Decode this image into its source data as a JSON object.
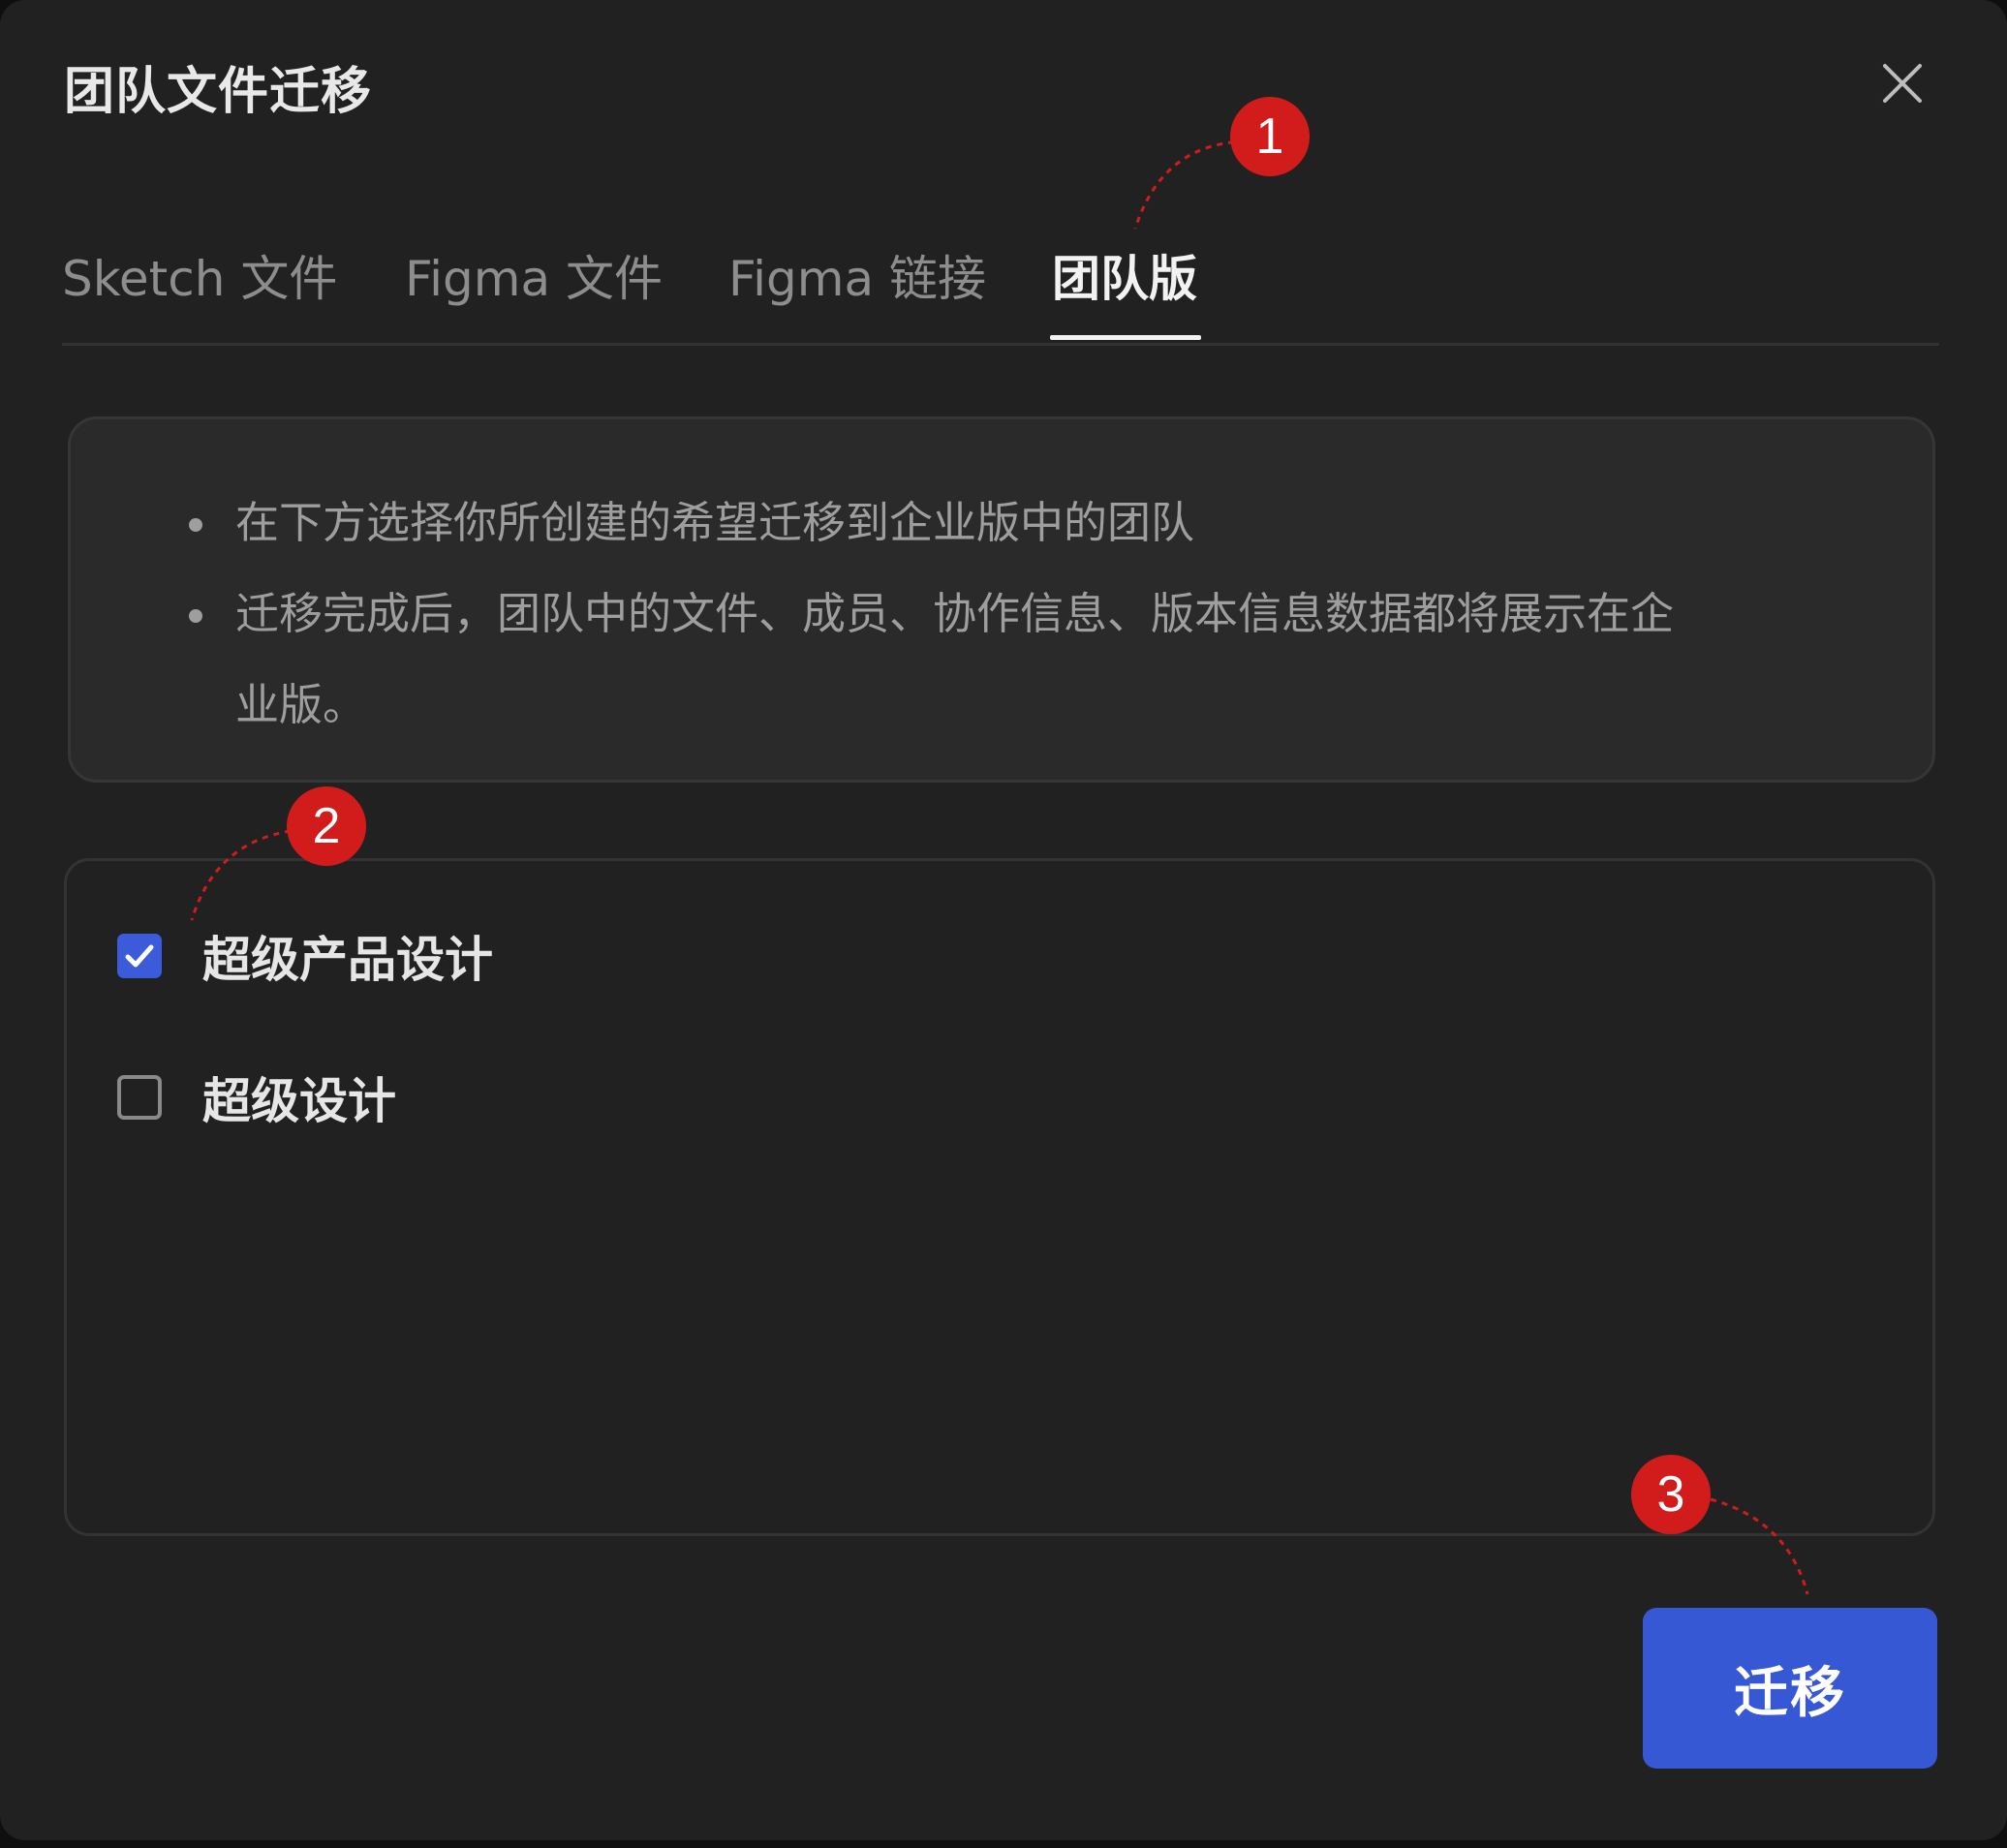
{
  "dialog": {
    "title": "团队文件迁移",
    "close_icon": "close-icon"
  },
  "tabs": [
    {
      "label": "Sketch 文件",
      "active": false
    },
    {
      "label": "Figma 文件",
      "active": false
    },
    {
      "label": "Figma 链接",
      "active": false
    },
    {
      "label": "团队版",
      "active": true
    }
  ],
  "info": {
    "line1": "在下方选择你所创建的希望迁移到企业版中的团队",
    "line2a": "迁移完成后，团队中的文件、成员、协作信息、版本信息数据都将展示在企",
    "line2b": "业版。"
  },
  "teams": [
    {
      "label": "超级产品设计",
      "checked": true
    },
    {
      "label": "超级设计",
      "checked": false
    }
  ],
  "actions": {
    "migrate_label": "迁移"
  },
  "annotations": {
    "badge1": "1",
    "badge2": "2",
    "badge3": "3"
  },
  "colors": {
    "background": "#212121",
    "accent": "#3658d4",
    "badge": "#d21c1c"
  }
}
